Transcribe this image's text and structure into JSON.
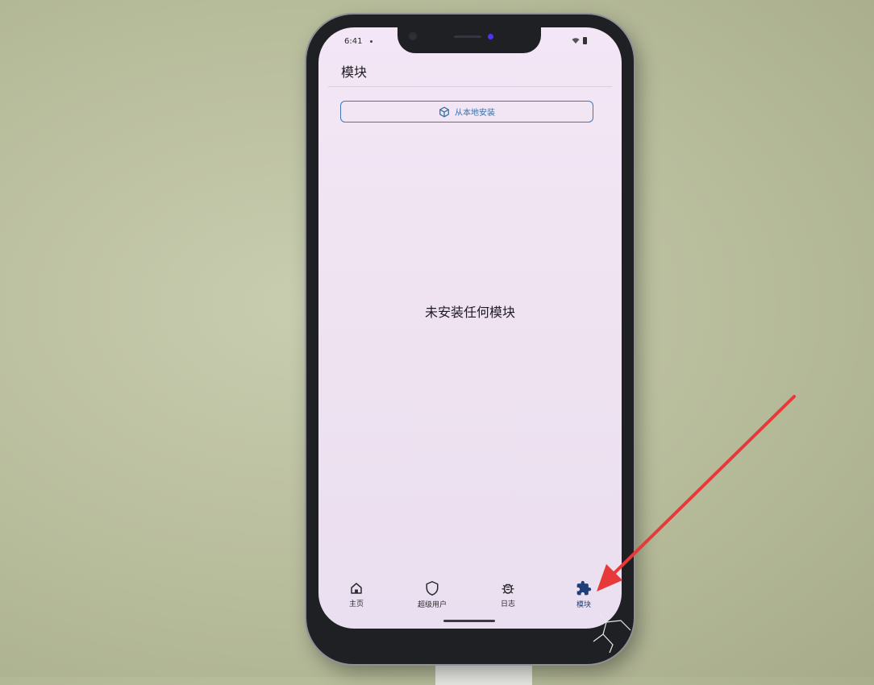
{
  "status_bar": {
    "time": "6:41"
  },
  "app_bar": {
    "title": "模块"
  },
  "install_button": {
    "label": "从本地安装",
    "icon": "package-icon"
  },
  "empty_state": {
    "message": "未安装任何模块"
  },
  "bottom_nav": {
    "items": [
      {
        "label": "主页",
        "icon": "home-icon"
      },
      {
        "label": "超级用户",
        "icon": "shield-icon"
      },
      {
        "label": "日志",
        "icon": "bug-icon"
      },
      {
        "label": "模块",
        "icon": "puzzle-icon",
        "active": true
      }
    ]
  },
  "colors": {
    "screen_bg": "#efe3f1",
    "accent": "#3f78b4",
    "active_icon": "#1f3f7a",
    "annotation_arrow": "#e8393a"
  }
}
